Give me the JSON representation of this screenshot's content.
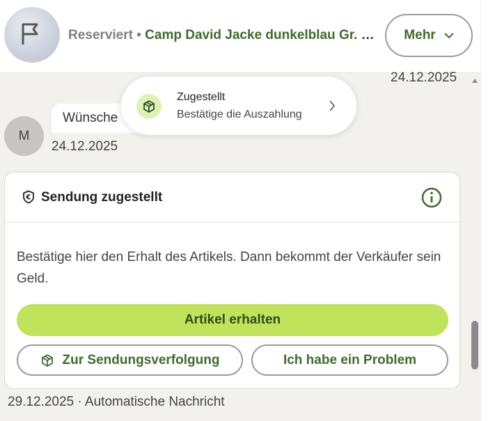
{
  "header": {
    "status": "Reserviert",
    "separator": " • ",
    "item_title": "Camp David Jacke dunkelblau Gr. XL",
    "more_label": "Mehr",
    "thumbnail_icon": "flag-icon"
  },
  "chat": {
    "top_date": "24.12.2025",
    "avatar_initial": "M",
    "message_text": "Wünsche",
    "message_date": "24.12.2025"
  },
  "toast": {
    "title": "Zugestellt",
    "subtitle": "Bestätige die Auszahlung",
    "icon": "package-icon"
  },
  "card": {
    "title": "Sendung zugestellt",
    "title_icon": "shield-euro-icon",
    "info_icon": "info-icon",
    "body": "Bestätige hier den Erhalt des Artikels. Dann bekommt der Verkäufer sein Geld.",
    "primary_button": "Artikel erhalten",
    "tracking_button": "Zur Sendungsverfolgung",
    "problem_button": "Ich habe ein Problem"
  },
  "footer": {
    "text": "29.12.2025 · Automatische Nachricht"
  },
  "colors": {
    "accent_green": "#3e6b2a",
    "primary_button_bg": "#c0e35c",
    "background": "#f2f1ee"
  }
}
